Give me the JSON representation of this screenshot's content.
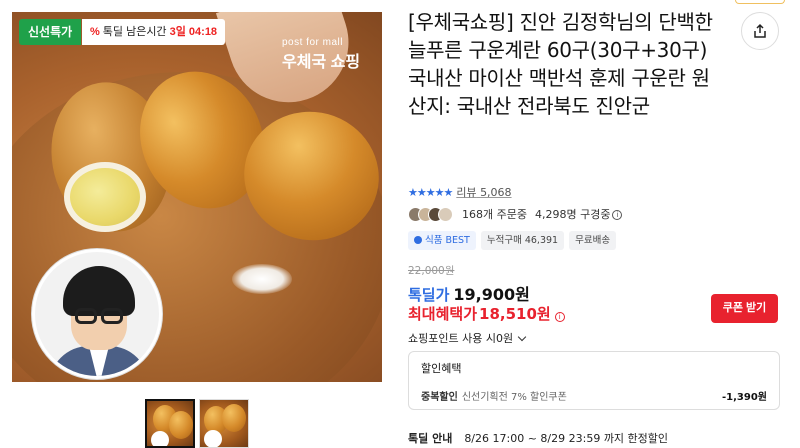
{
  "gallery": {
    "badge_special": "신선특가",
    "badge_timer_label": "톡딜 남은시간",
    "badge_timer_value": "3일 04:18",
    "badge_timer_mark": "%",
    "brand_small": "post for mall",
    "brand_name": "우체국 쇼핑"
  },
  "product": {
    "title": "[우체국쇼핑] 진안 김정학님의 단백한 늘푸른 구운계란 60구(30구+30구) 국내산 마이산 맥반석 훈제 구운란 원산지: 국내산 전라북도 진안군",
    "stars": "★★★★★",
    "review_label": "리뷰",
    "review_count": "5,068",
    "orders_text": "168개 주문중",
    "purchase_text": "4,298명 구경중",
    "chips": [
      "식품 BEST",
      "누적구매 46,391",
      "무료배송"
    ]
  },
  "price": {
    "original": "22,000원",
    "deal_label": "톡딜가",
    "deal_price": "19,900원",
    "max_label": "최대혜택가",
    "max_price": "18,510원",
    "coupon_button": "쿠폰 받기",
    "points": "쇼핑포인트 사용 시0원"
  },
  "discount": {
    "header": "할인혜택",
    "row_name": "중복할인",
    "row_detail": "신선기획전 7% 할인쿠폰",
    "row_amount": "-1,390원"
  },
  "deal_notice": {
    "label": "톡딜 안내",
    "text": "8/26 17:00 ~ 8/29 23:59 까지 한정할인"
  },
  "colors": {
    "accent_blue": "#2f6de1",
    "accent_red": "#e8222e",
    "badge_green": "#1fa14a"
  }
}
